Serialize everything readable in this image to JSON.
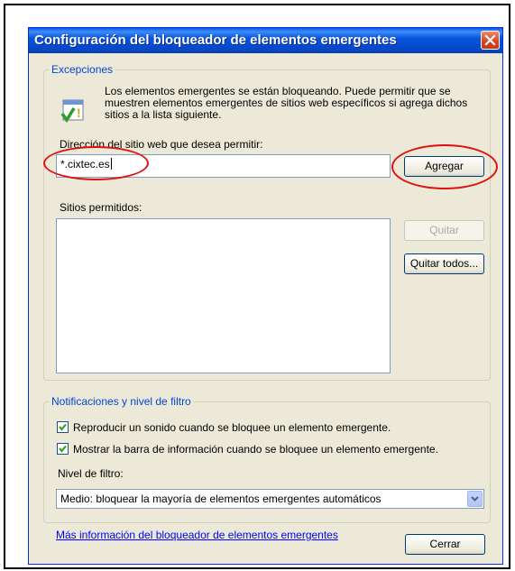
{
  "dialog": {
    "title": "Configuración del bloqueador de elementos emergentes"
  },
  "exceptions": {
    "legend": "Excepciones",
    "description": "Los elementos emergentes se están bloqueando. Puede permitir que se muestren elementos emergentes de sitios web específicos si agrega dichos sitios a la lista siguiente.",
    "address_label": "Dirección del sitio web que desea permitir:",
    "address_value": "*.cixtec.es",
    "add_button": "Agregar",
    "allowed_label": "Sitios permitidos:",
    "allowed_sites": [],
    "remove_button": "Quitar",
    "remove_all_button": "Quitar todos..."
  },
  "notifications": {
    "legend": "Notificaciones y nivel de filtro",
    "play_sound_label": "Reproducir un sonido cuando se bloquee un elemento emergente.",
    "play_sound_checked": true,
    "show_bar_label": "Mostrar la barra de información cuando se bloquee un elemento emergente.",
    "show_bar_checked": true,
    "filter_level_label": "Nivel de filtro:",
    "filter_level_value": "Medio: bloquear la mayoría de elementos emergentes automáticos"
  },
  "footer": {
    "more_info_link": "Más información del bloqueador de elementos emergentes",
    "close_button": "Cerrar"
  },
  "colors": {
    "titlebar": "#0a5ae8",
    "legend_text": "#0046d5",
    "highlight_oval": "#e01010",
    "dialog_bg": "#ece9d8"
  }
}
